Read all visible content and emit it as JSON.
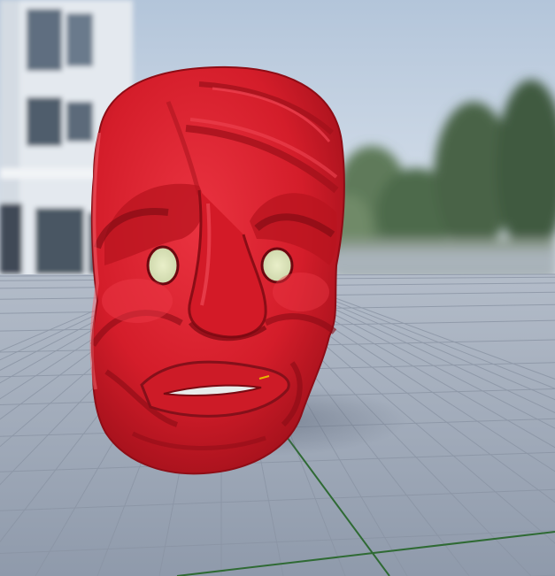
{
  "scene": {
    "sky_color": "#cfd9e6",
    "sky_top_color": "#a9bcd2",
    "floor_color": "#9aa4b4",
    "grid_line_color": "#8a94a4",
    "axis_x_color": "#2f6a34",
    "axis_y_color": "#2f6a34",
    "mask_color": "#e0202b",
    "mask_shadow_color": "#9e0f1a",
    "mask_highlight_color": "#f05060",
    "building_color": "#e8ecf0",
    "window_color": "#4b5866",
    "tree_color": "#4f6a4a",
    "gizmo_color": "#e8b400"
  }
}
